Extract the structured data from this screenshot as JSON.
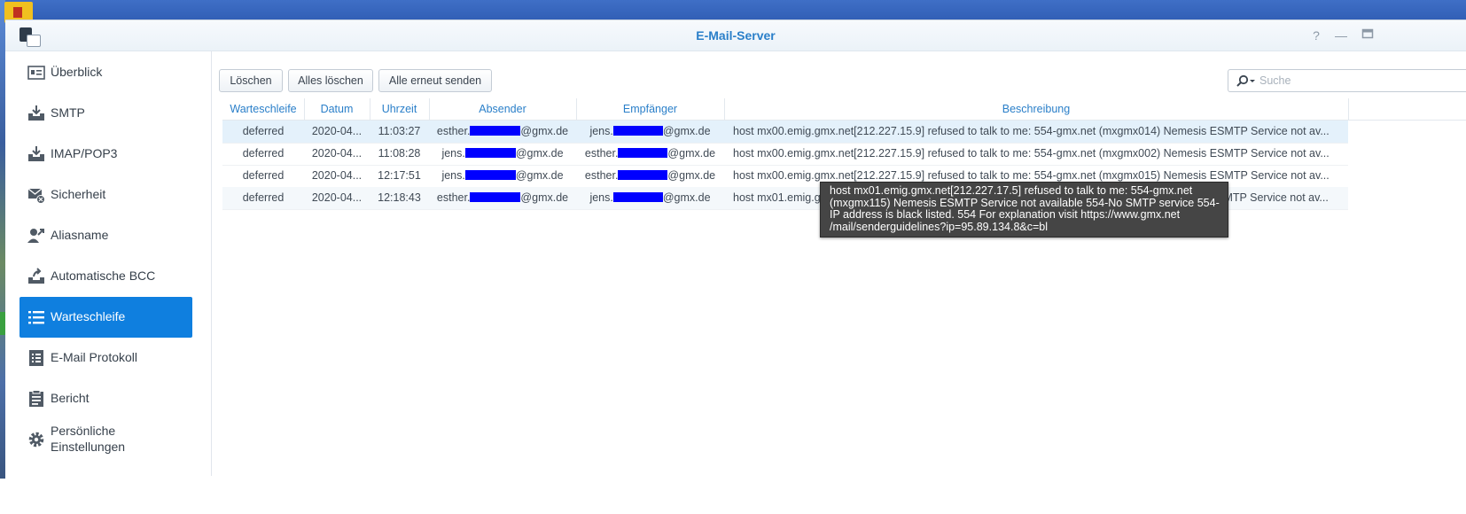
{
  "window": {
    "title": "E-Mail-Server"
  },
  "sidebar": {
    "items": [
      {
        "label": "Überblick",
        "icon": "overview-card-icon"
      },
      {
        "label": "SMTP",
        "icon": "inbox-download-icon"
      },
      {
        "label": "IMAP/POP3",
        "icon": "inbox-download-icon"
      },
      {
        "label": "Sicherheit",
        "icon": "mail-shield-icon"
      },
      {
        "label": "Aliasname",
        "icon": "user-alias-icon"
      },
      {
        "label": "Automatische BCC",
        "icon": "bcc-forward-icon"
      },
      {
        "label": "Warteschleife",
        "icon": "list-icon",
        "active": true
      },
      {
        "label": "E-Mail Protokoll",
        "icon": "log-document-icon"
      },
      {
        "label": "Bericht",
        "icon": "clipboard-report-icon"
      },
      {
        "label": "Persönliche Einstellungen",
        "icon": "gear-icon"
      }
    ]
  },
  "toolbar": {
    "delete_label": "Löschen",
    "delete_all_label": "Alles löschen",
    "resend_all_label": "Alle erneut senden",
    "search_placeholder": "Suche"
  },
  "table": {
    "headers": [
      "Warteschleife",
      "Datum",
      "Uhrzeit",
      "Absender",
      "Empfänger",
      "Beschreibung"
    ],
    "rows": [
      {
        "status": "deferred",
        "date": "2020-04...",
        "time": "11:03:27",
        "sender_user": "esther.",
        "sender_domain": "@gmx.de",
        "recipient_user": "jens.",
        "recipient_domain": "@gmx.de",
        "description": "host mx00.emig.gmx.net[212.227.15.9] refused to talk to me: 554-gmx.net (mxgmx014) Nemesis ESMTP Service not av..."
      },
      {
        "status": "deferred",
        "date": "2020-04...",
        "time": "11:08:28",
        "sender_user": "jens.",
        "sender_domain": "@gmx.de",
        "recipient_user": "esther.",
        "recipient_domain": "@gmx.de",
        "description": "host mx00.emig.gmx.net[212.227.15.9] refused to talk to me: 554-gmx.net (mxgmx002) Nemesis ESMTP Service not av..."
      },
      {
        "status": "deferred",
        "date": "2020-04...",
        "time": "12:17:51",
        "sender_user": "jens.",
        "sender_domain": "@gmx.de",
        "recipient_user": "esther.",
        "recipient_domain": "@gmx.de",
        "description": "host mx00.emig.gmx.net[212.227.15.9] refused to talk to me: 554-gmx.net (mxgmx015) Nemesis ESMTP Service not av..."
      },
      {
        "status": "deferred",
        "date": "2020-04...",
        "time": "12:18:43",
        "sender_user": "esther.",
        "sender_domain": "@gmx.de",
        "recipient_user": "jens.",
        "recipient_domain": "@gmx.de",
        "description": "host mx01.emig.gmx.net[212.227.17.5] refused to talk to me: 554-gmx.net (mxgmx115) Nemesis ESMTP Service not av..."
      }
    ]
  },
  "tooltip": {
    "text": "host mx01.emig.gmx.net[212.227.17.5] refused to talk to me: 554-gmx.net (mxgmx115) Nemesis ESMTP Service not available 554-No SMTP service 554-IP address is black listed. 554 For explanation visit https://www.gmx.net /mail/senderguidelines?ip=95.89.134.8&c=bl"
  },
  "colors": {
    "accent": "#0f7fdf",
    "header_text": "#2a7fc9",
    "redaction": "#0000ff"
  }
}
